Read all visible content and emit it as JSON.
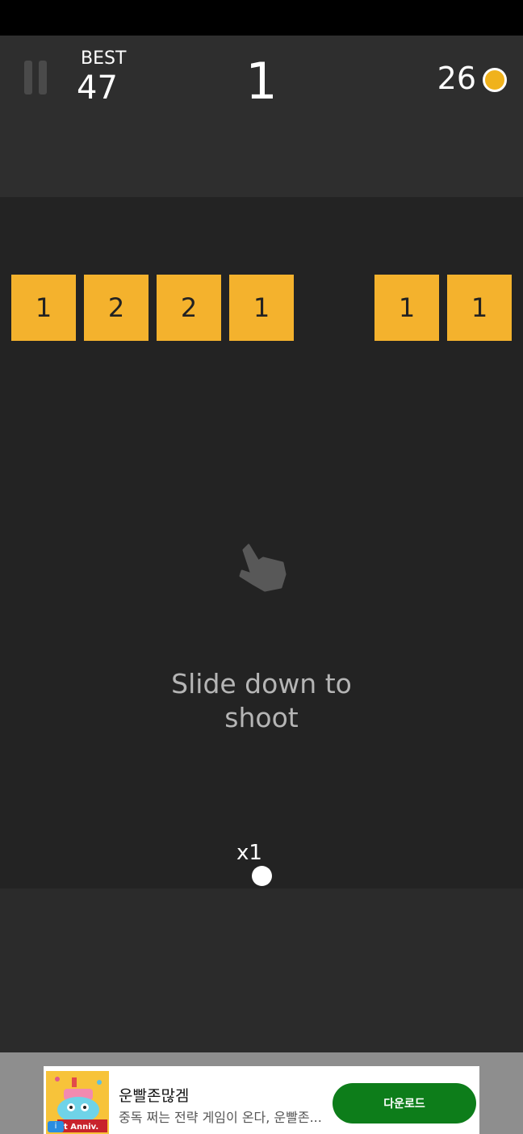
{
  "header": {
    "best_label": "BEST",
    "best_value": "47",
    "score": "1",
    "coins": "26"
  },
  "blocks": [
    "1",
    "2",
    "2",
    "1",
    "1",
    "1"
  ],
  "instruction": "Slide down to shoot",
  "ball_count": "x1",
  "ad": {
    "title": "운빨존많겜",
    "description": "중독 쩌는 전략 게임이 온다, 운빨존...",
    "download_label": "다운로드",
    "badge_text": "t Anniv."
  },
  "colors": {
    "block": "#f4b22d",
    "coin": "#f0b21c",
    "download_button": "#0d7d1a"
  }
}
